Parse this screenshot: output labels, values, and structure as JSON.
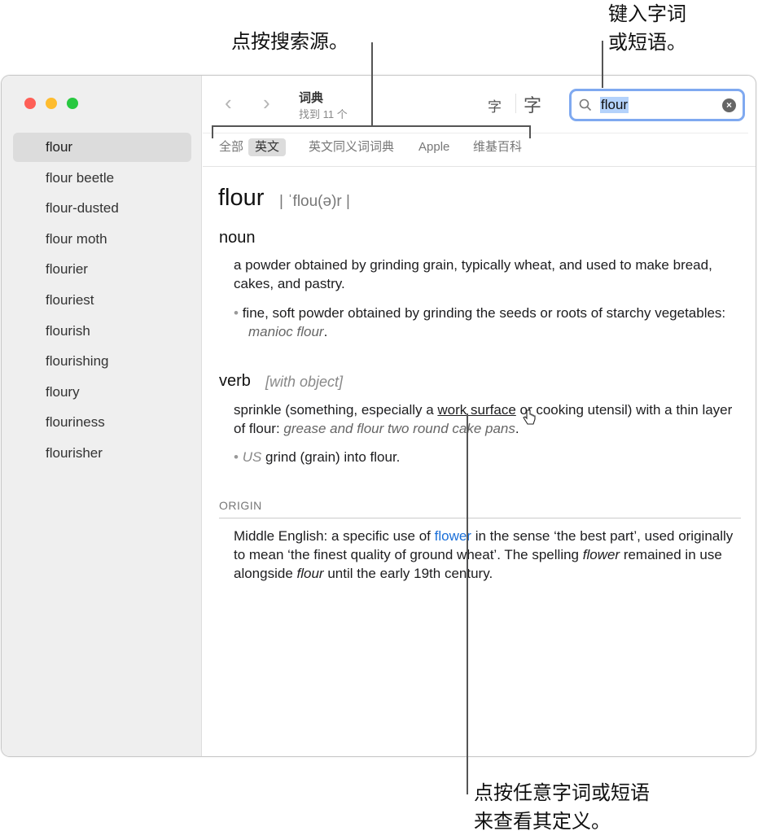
{
  "callouts": {
    "sources": "点按搜索源。",
    "search_line1": "键入字词",
    "search_line2": "或短语。",
    "word_line1": "点按任意字词或短语",
    "word_line2": "来查看其定义。"
  },
  "colors": {
    "accent": "#1a6fd8",
    "search_focus": "#7fa9f0",
    "selection": "#b4d2fb"
  },
  "sidebar": {
    "items": [
      {
        "label": "flour",
        "selected": true
      },
      {
        "label": "flour beetle"
      },
      {
        "label": "flour-dusted"
      },
      {
        "label": "flour moth"
      },
      {
        "label": "flourier"
      },
      {
        "label": "flouriest"
      },
      {
        "label": "flourish"
      },
      {
        "label": "flourishing"
      },
      {
        "label": "floury"
      },
      {
        "label": "flouriness"
      },
      {
        "label": "flourisher"
      }
    ]
  },
  "toolbar": {
    "title": "词典",
    "subtitle": "找到 11 个",
    "font_smaller": "字",
    "font_larger": "字",
    "search_value": "flour"
  },
  "tabs": [
    {
      "label": "全部"
    },
    {
      "label": "英文",
      "selected": true
    },
    {
      "label": "英文同义词词典"
    },
    {
      "label": "Apple"
    },
    {
      "label": "维基百科"
    }
  ],
  "entry": {
    "headword": "flour",
    "pronunciation": "| ˈflou(ə)r |",
    "noun": {
      "pos": "noun",
      "def1": "a powder obtained by grinding grain, typically wheat, and used to make bread, cakes, and pastry.",
      "def2": "fine, soft powder obtained by grinding the seeds or roots of starchy vegetables: ",
      "def2_example": "manioc flour",
      "def2_end": "."
    },
    "verb": {
      "pos": "verb",
      "grammar": "[with object]",
      "def1_a": "sprinkle (something, especially a ",
      "def1_link": "work surface",
      "def1_b": " or cooking utensil) with a thin layer of flour: ",
      "def1_example": "grease and flour two round cake pans",
      "def1_end": ".",
      "def2_region": "US",
      "def2": " grind (grain) into flour."
    },
    "origin": {
      "label": "ORIGIN",
      "t1": "Middle English: a specific use of ",
      "link": "flower",
      "t2": " in the sense ‘the best part’, used originally to mean ‘the finest quality of ground wheat’. The spelling ",
      "i1": "flower",
      "t3": " remained in use alongside ",
      "i2": "flour",
      "t4": " until the early 19th century."
    }
  }
}
